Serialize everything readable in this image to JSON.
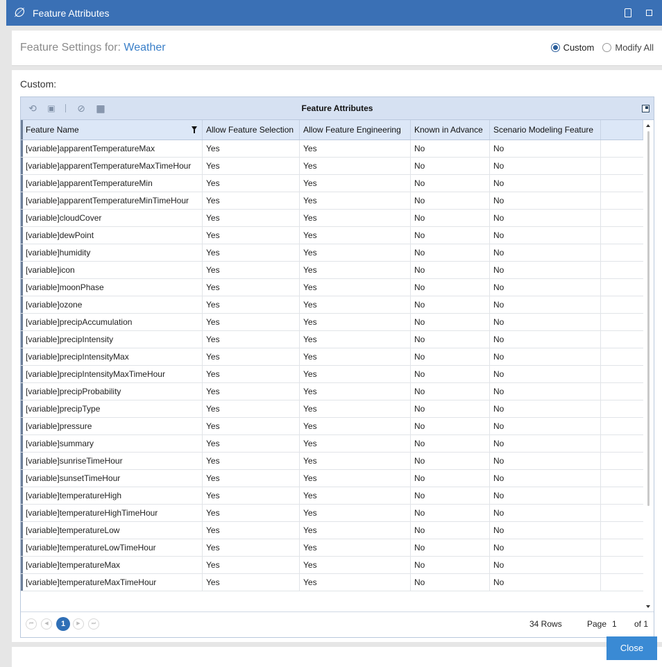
{
  "window": {
    "title": "Feature Attributes",
    "logo_glyph": "∅"
  },
  "header": {
    "label": "Feature Settings for: ",
    "value": "Weather",
    "mode_options": [
      {
        "label": "Custom",
        "selected": true
      },
      {
        "label": "Modify All",
        "selected": false
      }
    ]
  },
  "section_label": "Custom:",
  "grid": {
    "title": "Feature Attributes",
    "toolbar_icons": [
      "refresh-icon",
      "save-icon",
      "clear-filter-icon",
      "export-icon"
    ],
    "columns": [
      "Feature Name",
      "Allow Feature Selection",
      "Allow Feature Engineering",
      "Known in Advance",
      "Scenario Modeling Feature"
    ],
    "rows": [
      [
        "[variable]apparentTemperatureMax",
        "Yes",
        "Yes",
        "No",
        "No"
      ],
      [
        "[variable]apparentTemperatureMaxTimeHour",
        "Yes",
        "Yes",
        "No",
        "No"
      ],
      [
        "[variable]apparentTemperatureMin",
        "Yes",
        "Yes",
        "No",
        "No"
      ],
      [
        "[variable]apparentTemperatureMinTimeHour",
        "Yes",
        "Yes",
        "No",
        "No"
      ],
      [
        "[variable]cloudCover",
        "Yes",
        "Yes",
        "No",
        "No"
      ],
      [
        "[variable]dewPoint",
        "Yes",
        "Yes",
        "No",
        "No"
      ],
      [
        "[variable]humidity",
        "Yes",
        "Yes",
        "No",
        "No"
      ],
      [
        "[variable]icon",
        "Yes",
        "Yes",
        "No",
        "No"
      ],
      [
        "[variable]moonPhase",
        "Yes",
        "Yes",
        "No",
        "No"
      ],
      [
        "[variable]ozone",
        "Yes",
        "Yes",
        "No",
        "No"
      ],
      [
        "[variable]precipAccumulation",
        "Yes",
        "Yes",
        "No",
        "No"
      ],
      [
        "[variable]precipIntensity",
        "Yes",
        "Yes",
        "No",
        "No"
      ],
      [
        "[variable]precipIntensityMax",
        "Yes",
        "Yes",
        "No",
        "No"
      ],
      [
        "[variable]precipIntensityMaxTimeHour",
        "Yes",
        "Yes",
        "No",
        "No"
      ],
      [
        "[variable]precipProbability",
        "Yes",
        "Yes",
        "No",
        "No"
      ],
      [
        "[variable]precipType",
        "Yes",
        "Yes",
        "No",
        "No"
      ],
      [
        "[variable]pressure",
        "Yes",
        "Yes",
        "No",
        "No"
      ],
      [
        "[variable]summary",
        "Yes",
        "Yes",
        "No",
        "No"
      ],
      [
        "[variable]sunriseTimeHour",
        "Yes",
        "Yes",
        "No",
        "No"
      ],
      [
        "[variable]sunsetTimeHour",
        "Yes",
        "Yes",
        "No",
        "No"
      ],
      [
        "[variable]temperatureHigh",
        "Yes",
        "Yes",
        "No",
        "No"
      ],
      [
        "[variable]temperatureHighTimeHour",
        "Yes",
        "Yes",
        "No",
        "No"
      ],
      [
        "[variable]temperatureLow",
        "Yes",
        "Yes",
        "No",
        "No"
      ],
      [
        "[variable]temperatureLowTimeHour",
        "Yes",
        "Yes",
        "No",
        "No"
      ],
      [
        "[variable]temperatureMax",
        "Yes",
        "Yes",
        "No",
        "No"
      ],
      [
        "[variable]temperatureMaxTimeHour",
        "Yes",
        "Yes",
        "No",
        "No"
      ]
    ],
    "pager": {
      "current_page": "1",
      "rows_count": "34 Rows",
      "page_label": "Page",
      "page_value": "1",
      "of_label": "of 1"
    }
  },
  "footer": {
    "close_label": "Close"
  },
  "colors": {
    "titlebar": "#3a70b5",
    "accent": "#3a7fc8",
    "grid_header": "#dce7f7",
    "close_button": "#3a8ad4"
  }
}
